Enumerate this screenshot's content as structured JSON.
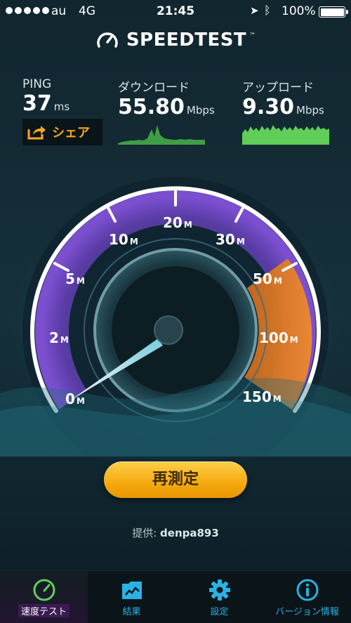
{
  "status_bar": {
    "carrier": "au",
    "network": "4G",
    "time": "21:45",
    "battery": "100%"
  },
  "app": {
    "logo_text": "SPEEDTEST",
    "trademark": "™"
  },
  "stats": {
    "ping": {
      "label": "PING",
      "value": "37",
      "unit": "ms"
    },
    "download": {
      "label": "ダウンロード",
      "value": "55.80",
      "unit": "Mbps"
    },
    "upload": {
      "label": "アップロード",
      "value": "9.30",
      "unit": "Mbps"
    }
  },
  "share_label": "シェア",
  "gauge": {
    "ticks": [
      {
        "num": "0",
        "unit": "M"
      },
      {
        "num": "2",
        "unit": "M"
      },
      {
        "num": "5",
        "unit": "M"
      },
      {
        "num": "10",
        "unit": "M"
      },
      {
        "num": "20",
        "unit": "M"
      },
      {
        "num": "30",
        "unit": "M"
      },
      {
        "num": "50",
        "unit": "M"
      },
      {
        "num": "100",
        "unit": "M"
      },
      {
        "num": "150",
        "unit": "M"
      }
    ],
    "needle_value_mbps": 0
  },
  "retest_label": "再測定",
  "provider": {
    "prefix": "提供:",
    "name": "denpa893"
  },
  "tabs": [
    {
      "label": "速度テスト",
      "icon": "speedometer-icon",
      "active": true
    },
    {
      "label": "結果",
      "icon": "folder-icon",
      "active": false
    },
    {
      "label": "設定",
      "icon": "gear-icon",
      "active": false
    },
    {
      "label": "バージョン情報",
      "icon": "info-icon",
      "active": false
    }
  ],
  "colors": {
    "accent": "#f5a623",
    "tab_blue": "#29b2e6",
    "gauge_purple": "#7b4fd0",
    "gauge_orange": "#ef8a2a",
    "graph_green": "#5fcf5a"
  }
}
